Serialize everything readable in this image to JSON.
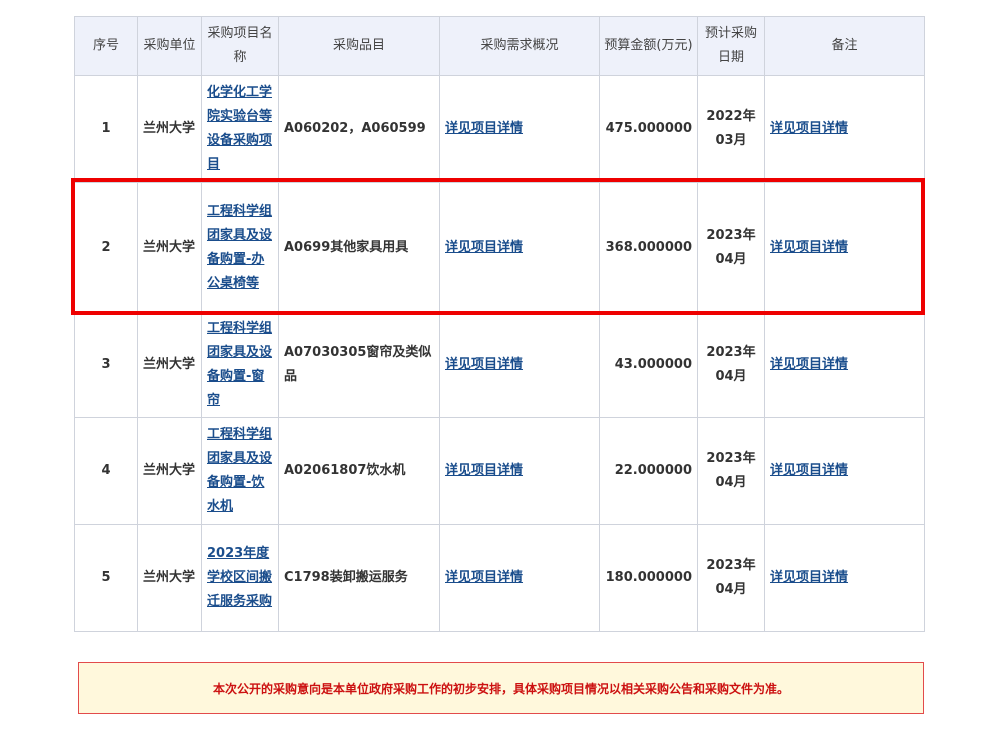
{
  "table": {
    "headers": [
      "序号",
      "采购单位",
      "采购项目名称",
      "采购品目",
      "采购需求概况",
      "预算金额(万元)",
      "预计采购日期",
      "备注"
    ],
    "rows": [
      {
        "index": "1",
        "unit": "兰州大学",
        "project": "化学化工学院实验台等设备采购项目",
        "item": "A060202，A060599",
        "demand": "详见项目详情",
        "budget": "475.000000",
        "date": "2022年03月",
        "remark": "详见项目详情"
      },
      {
        "index": "2",
        "unit": "兰州大学",
        "project": "工程科学组团家具及设备购置-办公桌椅等",
        "item": "A0699其他家具用具",
        "demand": "详见项目详情",
        "budget": "368.000000",
        "date": "2023年04月",
        "remark": "详见项目详情"
      },
      {
        "index": "3",
        "unit": "兰州大学",
        "project": "工程科学组团家具及设备购置-窗帘",
        "item": "A07030305窗帘及类似品",
        "demand": "详见项目详情",
        "budget": "43.000000",
        "date": "2023年04月",
        "remark": "详见项目详情"
      },
      {
        "index": "4",
        "unit": "兰州大学",
        "project": "工程科学组团家具及设备购置-饮水机",
        "item": "A02061807饮水机",
        "demand": "详见项目详情",
        "budget": "22.000000",
        "date": "2023年04月",
        "remark": "详见项目详情"
      },
      {
        "index": "5",
        "unit": "兰州大学",
        "project": "2023年度学校区间搬迁服务采购",
        "item": "C1798装卸搬运服务",
        "demand": "详见项目详情",
        "budget": "180.000000",
        "date": "2023年04月",
        "remark": "详见项目详情"
      }
    ]
  },
  "notice": "本次公开的采购意向是本单位政府采购工作的初步安排，具体采购项目情况以相关采购公告和采购文件为准。",
  "colors": {
    "header_bg": "#eef1fa",
    "link": "#1a4d8c",
    "highlight_border": "#ee0000",
    "notice_bg": "#fff8dc",
    "notice_text": "#cc1111"
  }
}
